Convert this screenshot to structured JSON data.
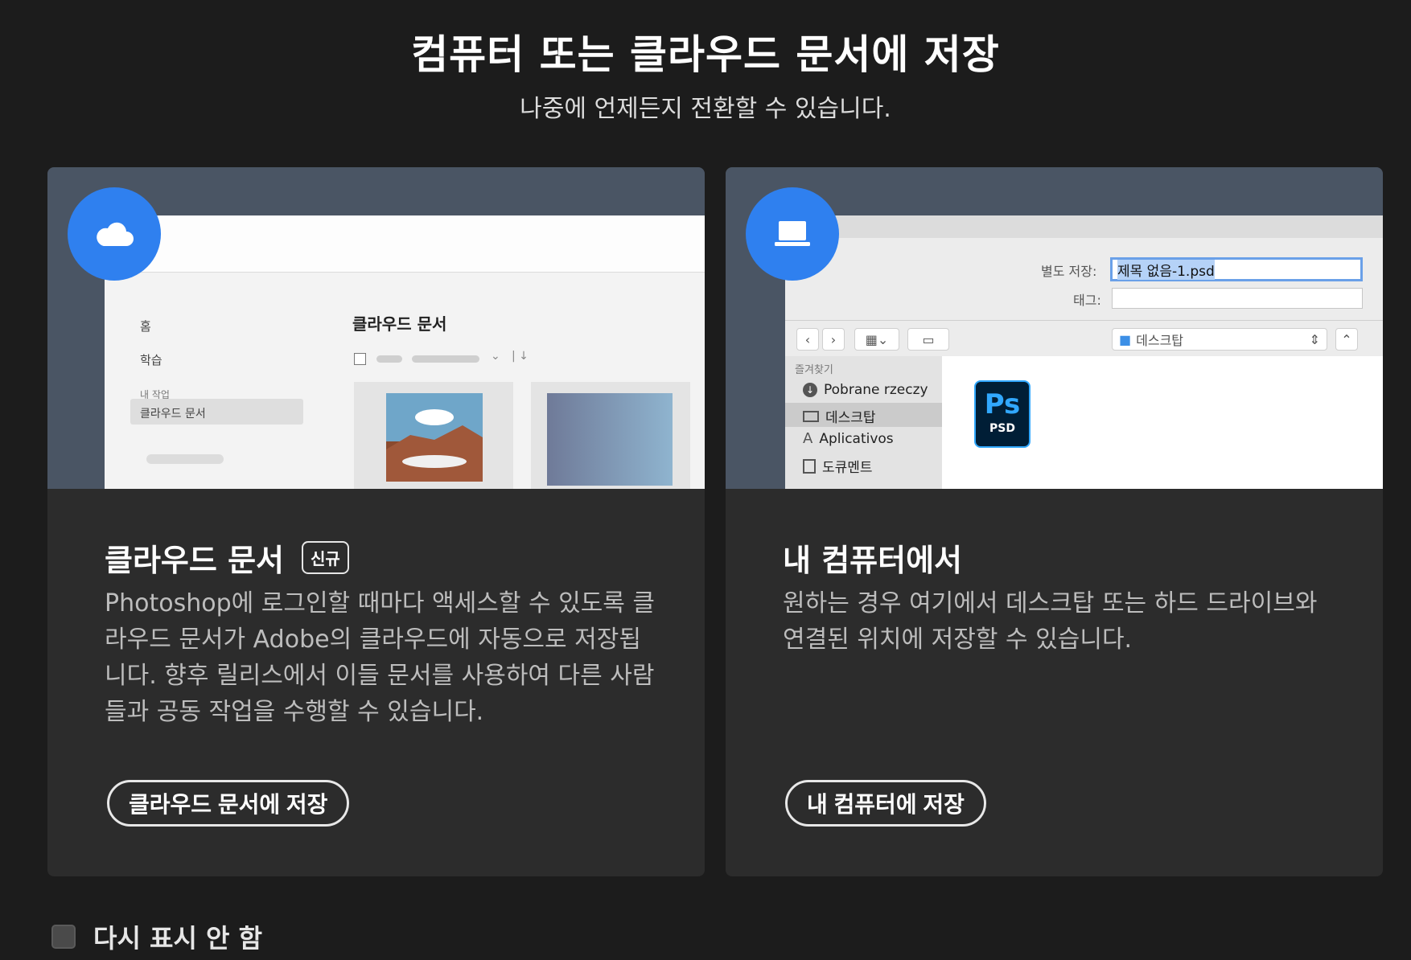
{
  "header": {
    "title": "컴퓨터 또는 클라우드 문서에 저장",
    "subtitle": "나중에 언제든지 전환할 수 있습니다."
  },
  "cloud_card": {
    "icon": "cloud-icon",
    "title": "클라우드 문서",
    "badge": "신규",
    "description": "Photoshop에 로그인할 때마다 액세스할 수 있도록 클라우드 문서가 Adobe의 클라우드에 자동으로 저장됩니다. 향후 릴리스에서 이들 문서를 사용하여 다른 사람들과 공동 작업을 수행할 수 있습니다.",
    "button_label": "클라우드 문서에 저장",
    "preview": {
      "nav_home": "홈",
      "nav_learn": "학습",
      "nav_my_work": "내 작업",
      "nav_cloud_docs": "클라우드 문서",
      "heading": "클라우드 문서"
    }
  },
  "computer_card": {
    "icon": "laptop-icon",
    "title": "내 컴퓨터에서",
    "description": "원하는 경우 여기에서 데스크탑 또는 하드 드라이브와 연결된 위치에 저장할 수 있습니다.",
    "button_label": "내 컴퓨터에 저장",
    "preview": {
      "save_as_label": "별도 저장:",
      "save_as_value": "제목 없음-1.psd",
      "tags_label": "태그:",
      "location": "데스크탑",
      "favorites_label": "즐겨찾기",
      "sidebar_items": [
        "Pobrane rzeczy",
        "데스크탑",
        "Aplicativos",
        "도큐멘트"
      ],
      "file_icon_text": "Ps",
      "file_type": "PSD"
    }
  },
  "footer": {
    "dont_show_label": "다시 표시 안 함",
    "dont_show_checked": false
  },
  "colors": {
    "background": "#1c1c1c",
    "card": "#2c2c2c",
    "accent_blue": "#2f80ef",
    "preview_bg": "#4a5564"
  }
}
